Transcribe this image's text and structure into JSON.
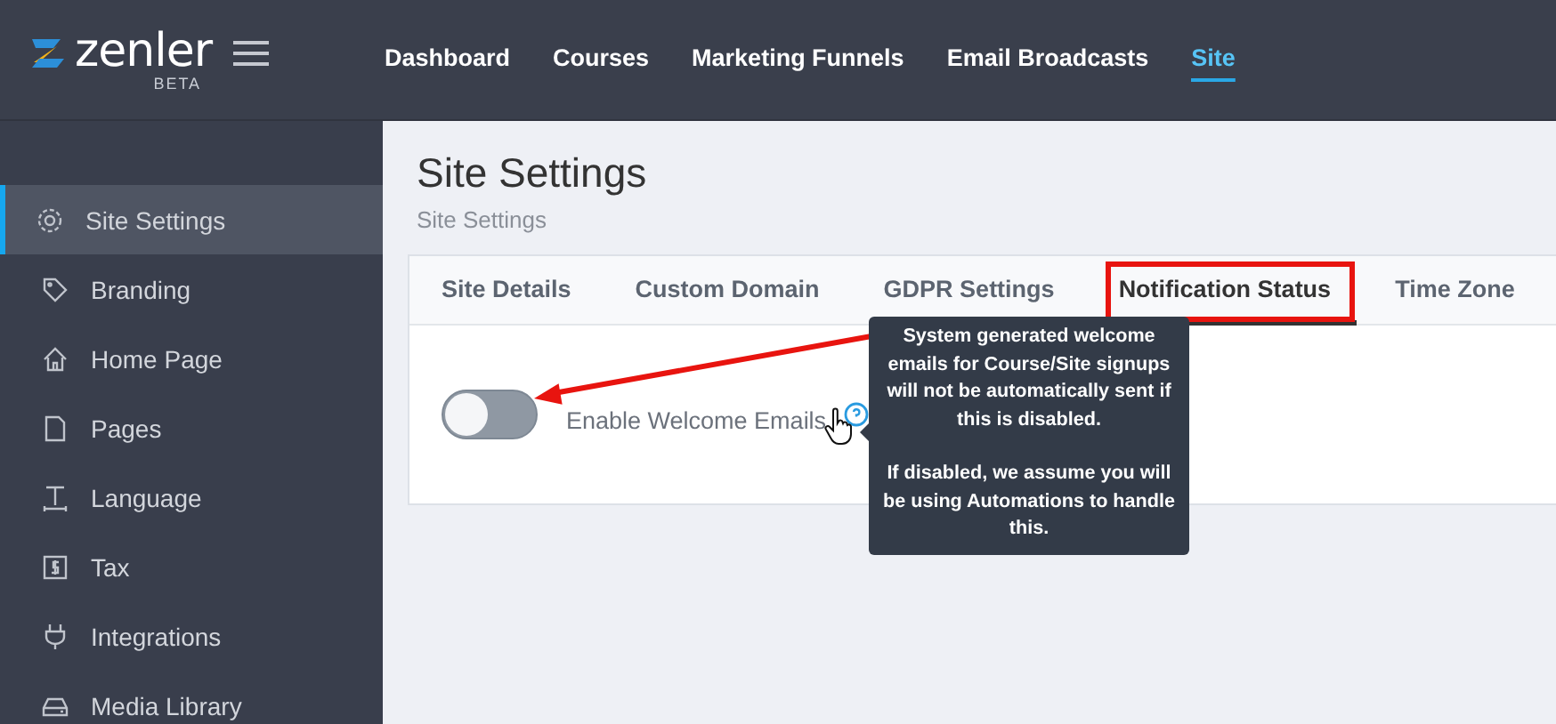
{
  "header": {
    "logo": "zenler",
    "badge": "BETA",
    "nav": [
      {
        "label": "Dashboard",
        "selected": false
      },
      {
        "label": "Courses",
        "selected": false
      },
      {
        "label": "Marketing Funnels",
        "selected": false
      },
      {
        "label": "Email Broadcasts",
        "selected": false
      },
      {
        "label": "Site",
        "selected": true
      }
    ]
  },
  "sidebar": {
    "items": [
      {
        "label": "Site Settings",
        "selected": true
      },
      {
        "label": "Branding",
        "selected": false
      },
      {
        "label": "Home Page",
        "selected": false
      },
      {
        "label": "Pages",
        "selected": false
      },
      {
        "label": "Language",
        "selected": false
      },
      {
        "label": "Tax",
        "selected": false
      },
      {
        "label": "Integrations",
        "selected": false
      },
      {
        "label": "Media Library",
        "selected": false
      }
    ]
  },
  "page": {
    "title": "Site Settings",
    "breadcrumb": "Site Settings"
  },
  "tabs": [
    {
      "label": "Site Details",
      "selected": false
    },
    {
      "label": "Custom Domain",
      "selected": false
    },
    {
      "label": "GDPR Settings",
      "selected": false
    },
    {
      "label": "Notification Status",
      "selected": true
    },
    {
      "label": "Time Zone",
      "selected": false
    }
  ],
  "setting": {
    "label": "Enable Welcome Emails",
    "on": false
  },
  "tooltip": {
    "paragraphs": [
      "System generated welcome emails for Course/Site signups will not be automatically sent if this is disabled.",
      "If disabled, we assume you will be using Automations to handle this."
    ]
  },
  "annotation": {
    "highlight_box": true,
    "arrow": true
  }
}
